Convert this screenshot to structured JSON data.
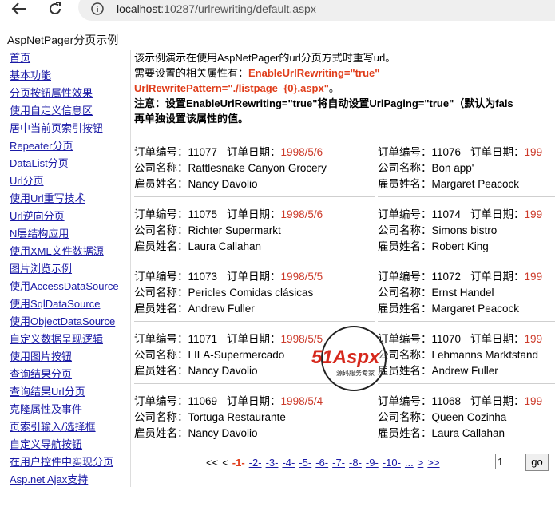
{
  "browser": {
    "url_host": "localhost",
    "url_rest": ":10287/urlrewriting/default.aspx",
    "icons": [
      "back-arrow-icon",
      "reload-icon",
      "info-icon"
    ]
  },
  "page_title": "AspNetPager分页示例",
  "sidebar": {
    "items": [
      "首页",
      "基本功能",
      "分页按钮属性效果",
      "使用自定义信息区",
      "居中当前页索引按钮",
      "Repeater分页",
      "DataList分页",
      "Url分页",
      "使用Url重写技术",
      "Url逆向分页",
      "N层结构应用",
      "使用XML文件数据源",
      "图片浏览示例",
      "使用AccessDataSource",
      "使用SqlDataSource",
      "使用ObjectDataSource",
      "自定义数据呈现逻辑",
      "使用图片按钮",
      "查询结果分页",
      "查询结果Url分页",
      "克隆属性及事件",
      "页索引输入/选择框",
      "自定义导航按钮",
      "在用户控件中实现分页",
      "Asp.net Ajax支持"
    ]
  },
  "intro": {
    "line1": "该示例演示在使用AspNetPager的url分页方式时重写url。",
    "line2_prefix": "需要设置的相关属性有：",
    "line2_red": "EnableUrlRewriting=\"true\"",
    "line3_red": "UrlRewritePattern=\"./listpage_{0}.aspx\"",
    "line3_suffix": "。",
    "line4": "注意：设置EnableUrlRewriting=\"true\"将自动设置UrlPaging=\"true\"（默认为fals",
    "line5": "再单独设置该属性的值。"
  },
  "labels": {
    "order_no": "订单编号：",
    "order_date": "订单日期：",
    "company": "公司名称：",
    "employee": "雇员姓名："
  },
  "orders": [
    {
      "no": "11077",
      "date": "1998/5/6",
      "company": "Rattlesnake Canyon Grocery",
      "employee": "Nancy Davolio"
    },
    {
      "no": "11076",
      "date": "199",
      "company": "Bon app'",
      "employee": "Margaret Peacock"
    },
    {
      "no": "11075",
      "date": "1998/5/6",
      "company": "Richter Supermarkt",
      "employee": "Laura Callahan"
    },
    {
      "no": "11074",
      "date": "199",
      "company": "Simons bistro",
      "employee": "Robert King"
    },
    {
      "no": "11073",
      "date": "1998/5/5",
      "company": "Pericles Comidas clásicas",
      "employee": "Andrew Fuller"
    },
    {
      "no": "11072",
      "date": "199",
      "company": "Ernst Handel",
      "employee": "Margaret Peacock"
    },
    {
      "no": "11071",
      "date": "1998/5/5",
      "company": "LILA-Supermercado",
      "employee": "Nancy Davolio"
    },
    {
      "no": "11070",
      "date": "199",
      "company": "Lehmanns Marktstand",
      "employee": "Andrew Fuller"
    },
    {
      "no": "11069",
      "date": "1998/5/4",
      "company": "Tortuga Restaurante",
      "employee": "Nancy Davolio"
    },
    {
      "no": "11068",
      "date": "199",
      "company": "Queen Cozinha",
      "employee": "Laura Callahan"
    }
  ],
  "pager": {
    "first": "<<",
    "prev": "<",
    "current": "-1-",
    "pages": [
      "-2-",
      "-3-",
      "-4-",
      "-5-",
      "-6-",
      "-7-",
      "-8-",
      "-9-",
      "-10-"
    ],
    "more": "...",
    "next": ">",
    "last": ">>",
    "input_value": "1",
    "go_label": "go"
  },
  "watermark": {
    "brand": "51Aspx",
    "tagline": "源码服务专家"
  },
  "colors": {
    "link": "#1a1aa6",
    "accent_red": "#e03d1a",
    "date_red": "#cc3a2a"
  }
}
